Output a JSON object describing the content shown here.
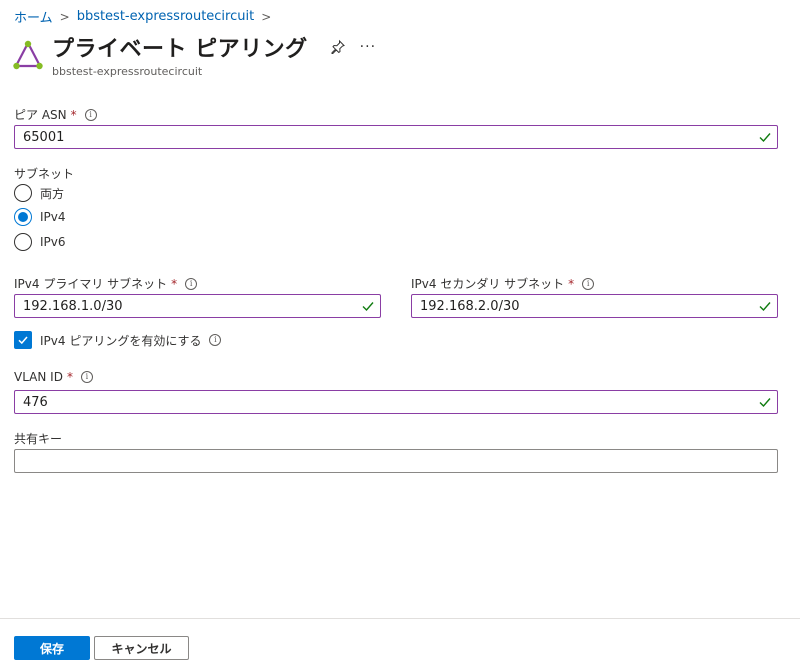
{
  "breadcrumb": {
    "items": [
      {
        "label": "ホーム"
      },
      {
        "label": "bbstest-expressroutecircuit"
      }
    ]
  },
  "header": {
    "title": "プライベート ピアリング",
    "subtitle": "bbstest-expressroutecircuit",
    "more_label": "···"
  },
  "form": {
    "peer_asn": {
      "label": "ピア ASN",
      "required_mark": "*",
      "value": "65001"
    },
    "subnet": {
      "label": "サブネット",
      "options": [
        {
          "label": "両方",
          "checked": false
        },
        {
          "label": "IPv4",
          "checked": true
        },
        {
          "label": "IPv6",
          "checked": false
        }
      ]
    },
    "ipv4_primary": {
      "label": "IPv4 プライマリ サブネット",
      "required_mark": "*",
      "value": "192.168.1.0/30"
    },
    "ipv4_secondary": {
      "label": "IPv4 セカンダリ サブネット",
      "required_mark": "*",
      "value": "192.168.2.0/30"
    },
    "enable_ipv4": {
      "label": "IPv4 ピアリングを有効にする",
      "checked": true
    },
    "vlan_id": {
      "label": "VLAN ID",
      "required_mark": "*",
      "value": "476"
    },
    "shared_key": {
      "label": "共有キー",
      "value": ""
    }
  },
  "footer": {
    "save_label": "保存",
    "cancel_label": "キャンセル"
  },
  "colors": {
    "accent": "#0078d4",
    "link": "#0063b1",
    "valid_border": "#8a3ea4",
    "valid_check": "#107c10",
    "required": "#a4262c"
  },
  "info_glyph": "i"
}
